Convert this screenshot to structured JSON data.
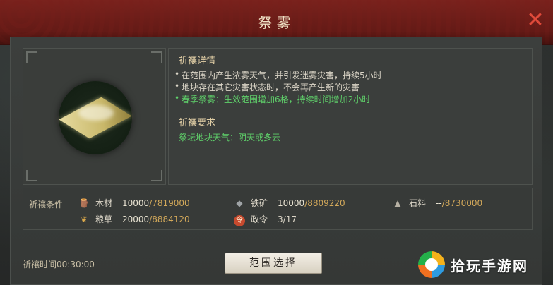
{
  "title": "祭雾",
  "close_icon": "close-icon",
  "details": {
    "heading": "祈禳详情",
    "bullets": [
      {
        "text": "在范围内产生浓雾天气，并引发迷雾灾害，持续5小时",
        "color": "#dcd6c8"
      },
      {
        "text": "地块存在其它灾害状态时，不会再产生新的灾害",
        "color": "#dcd6c8"
      },
      {
        "text": "春季祭雾：生效范围增加6格，持续时间增加2小时",
        "color": "#5fd06a"
      }
    ]
  },
  "requirements": {
    "heading": "祈禳要求",
    "text": "祭坛地块天气：阴天或多云"
  },
  "conditions": {
    "label": "祈禳条件",
    "wood": {
      "icon": "wood-icon",
      "name": "木材",
      "need": "10000",
      "have": "/7819000"
    },
    "iron": {
      "icon": "iron-ore-icon",
      "name": "铁矿",
      "need": "10000",
      "have": "/8809220"
    },
    "stone": {
      "icon": "stone-icon",
      "name": "石料",
      "need": "--",
      "have": "/8730000"
    },
    "grain": {
      "icon": "grain-icon",
      "name": "粮草",
      "need": "20000",
      "have": "/8884120"
    },
    "order": {
      "icon": "decree-icon",
      "icon_glyph": "令",
      "name": "政令",
      "value": "3/17"
    }
  },
  "time_text": "祈禳时间00:30:00",
  "range_button": "范围选择",
  "watermark": {
    "text": "拾玩手游网"
  },
  "colors": {
    "title_bar": "#7a221d",
    "green_text": "#5fd06a",
    "have_amount": "#d2a85a",
    "close": "#e04a3a"
  }
}
